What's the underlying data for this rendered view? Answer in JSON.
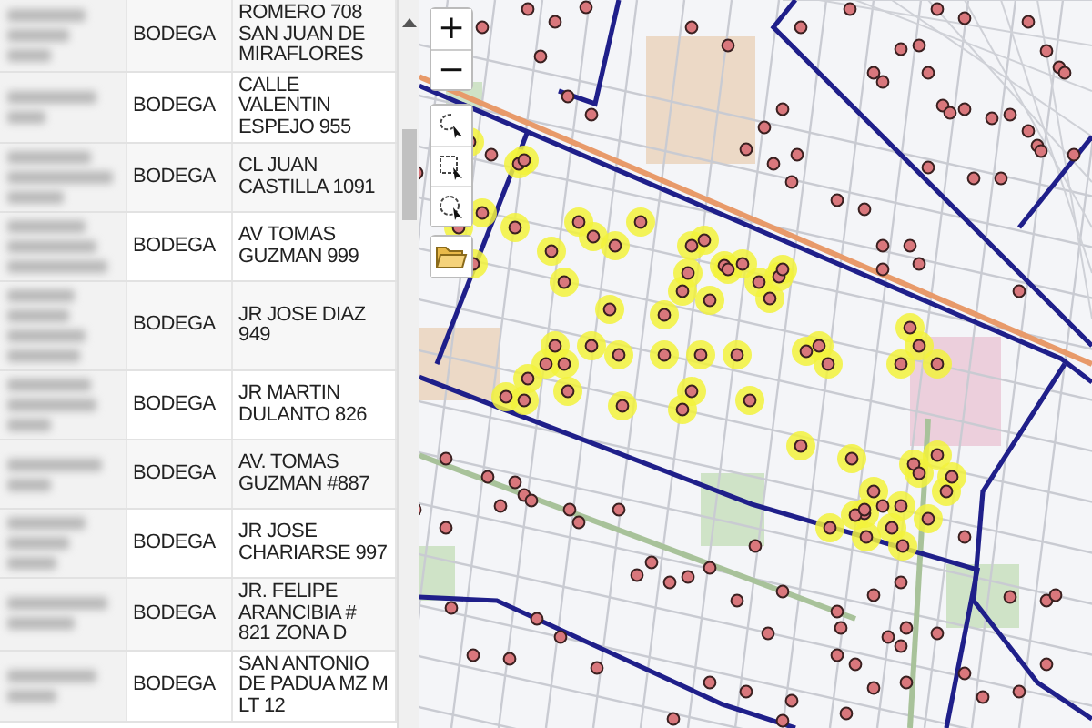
{
  "table": {
    "rows": [
      {
        "type": "BODEGA",
        "address": "ROMERO 708 SAN JUAN DE MIRAFLORES"
      },
      {
        "type": "BODEGA",
        "address": "CALLE VALENTIN ESPEJO 955"
      },
      {
        "type": "BODEGA",
        "address": "CL JUAN CASTILLA 1091"
      },
      {
        "type": "BODEGA",
        "address": "AV TOMAS GUZMAN 999"
      },
      {
        "type": "BODEGA",
        "address": "JR JOSE DIAZ 949"
      },
      {
        "type": "BODEGA",
        "address": "JR MARTIN DULANTO 826"
      },
      {
        "type": "BODEGA",
        "address": "AV. TOMAS GUZMAN #887"
      },
      {
        "type": "BODEGA",
        "address": "JR JOSE CHARIARSE 997"
      },
      {
        "type": "BODEGA",
        "address": "JR. FELIPE ARANCIBIA # 821 ZONA D"
      },
      {
        "type": "BODEGA",
        "address": "SAN ANTONIO DE PADUA MZ M LT 12"
      }
    ]
  },
  "map_controls": {
    "zoom_in": "+",
    "zoom_out": "−"
  }
}
